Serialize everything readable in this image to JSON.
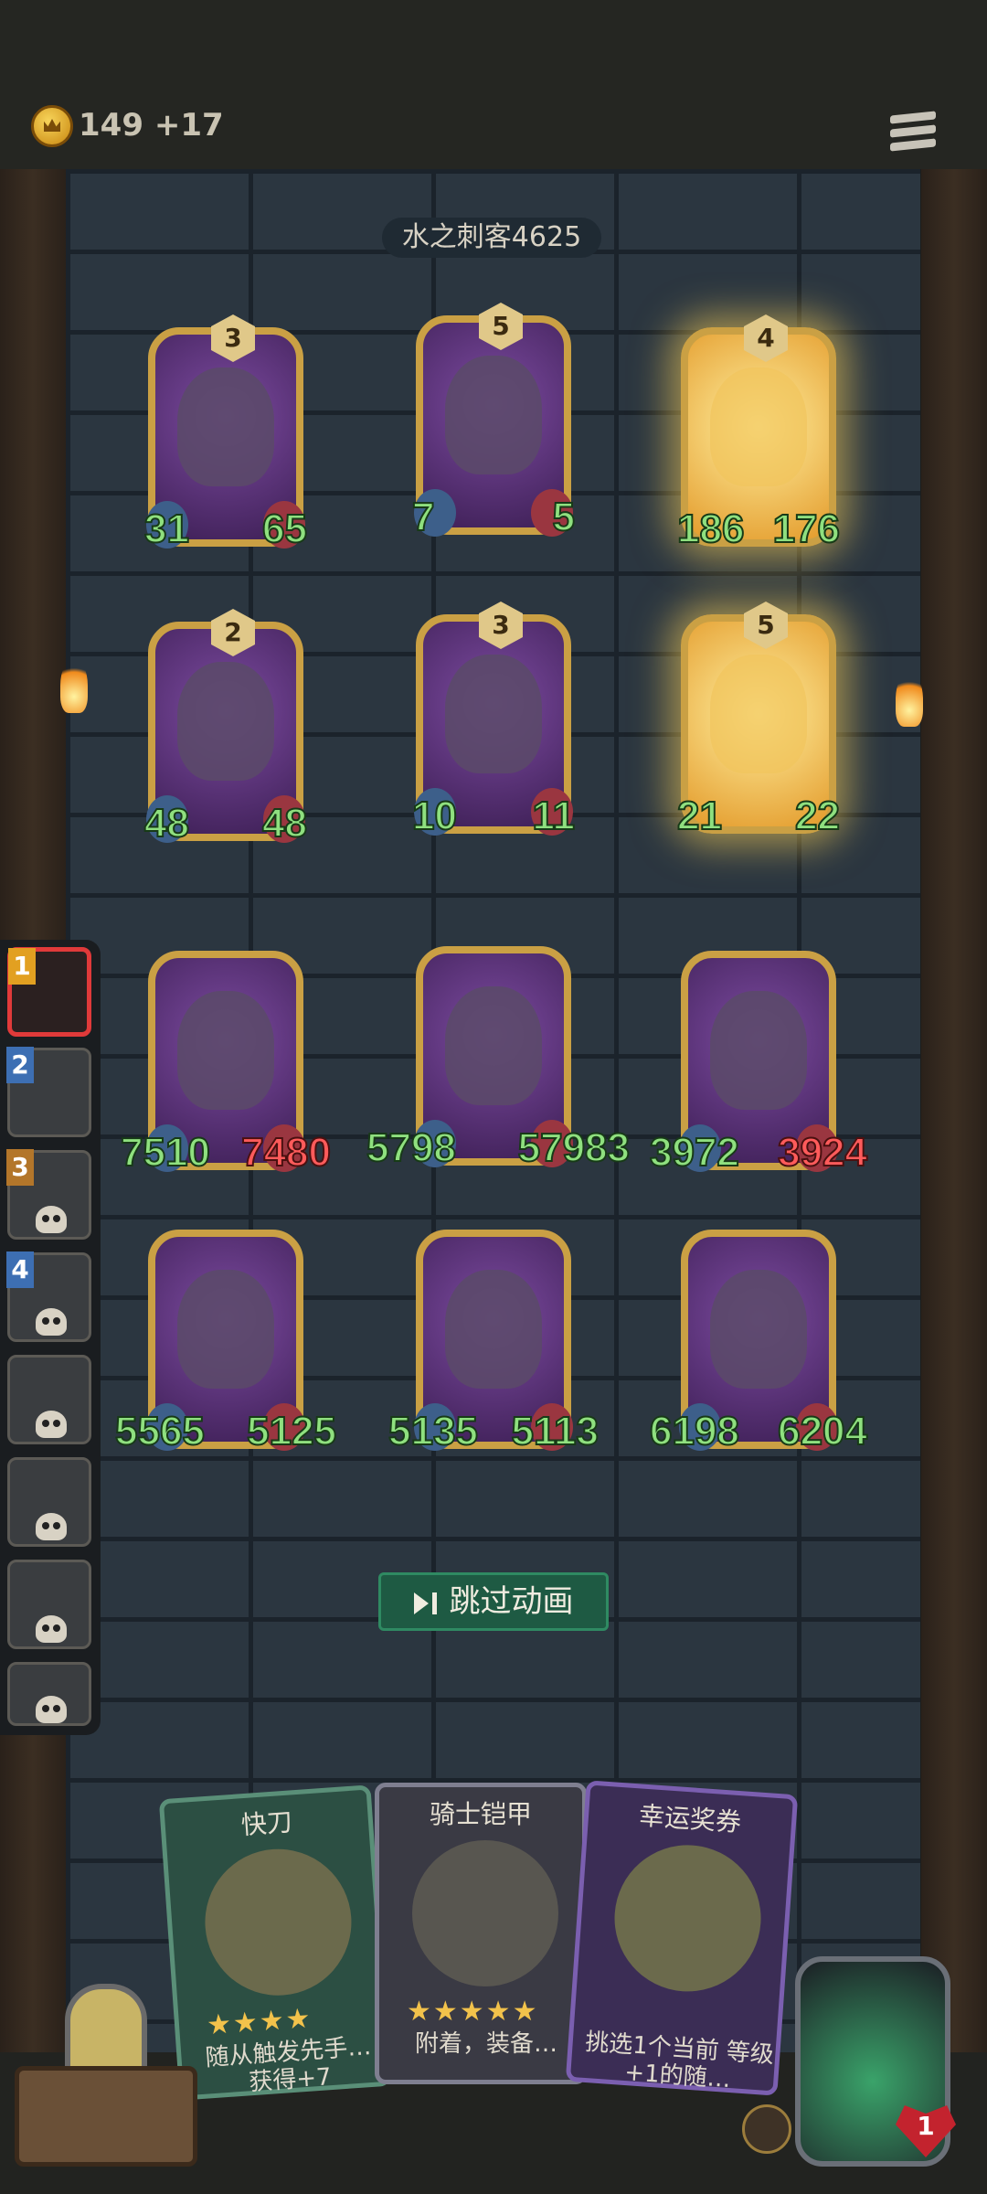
{
  "header": {
    "gold": "149",
    "gold_income": "+17"
  },
  "opponent": {
    "name": "水之刺客4625"
  },
  "enemy_board": [
    {
      "level": "3",
      "attack": "31",
      "health": "65"
    },
    {
      "level": "5",
      "attack": "7",
      "health": "5"
    },
    {
      "level": "4",
      "attack": "186",
      "health": "176"
    },
    {
      "level": "2",
      "attack": "48",
      "health": "48"
    },
    {
      "level": "3",
      "attack": "10",
      "health": "11"
    },
    {
      "level": "5",
      "attack": "21",
      "health": "22"
    }
  ],
  "player_board": [
    {
      "attack": "7510",
      "health": "7480",
      "health_damaged": true
    },
    {
      "attack": "5798",
      "health": "57983"
    },
    {
      "attack": "3972",
      "health": "3924",
      "health_damaged": true
    },
    {
      "attack": "5565",
      "health": "5125"
    },
    {
      "attack": "5135",
      "health": "5113"
    },
    {
      "attack": "6198",
      "health": "6204"
    }
  ],
  "sidebar": {
    "ranks": [
      "1",
      "2",
      "3",
      "4"
    ]
  },
  "skip_button": {
    "label": "跳过动画"
  },
  "shop": [
    {
      "title": "快刀",
      "stars": "★★★★",
      "desc": "随从触发先手… 获得+7"
    },
    {
      "title": "骑士铠甲",
      "stars": "★★★★★",
      "desc": "附着，装备…"
    },
    {
      "title": "幸运奖券",
      "stars": "",
      "desc": "挑选1个当前 等级+1的随…"
    }
  ],
  "player": {
    "lives": "1"
  },
  "colors": {
    "accent_gold": "#caa044",
    "stat_green": "#8fe07f",
    "stat_red": "#ff5b5b",
    "skip_green": "#1e5a43"
  }
}
